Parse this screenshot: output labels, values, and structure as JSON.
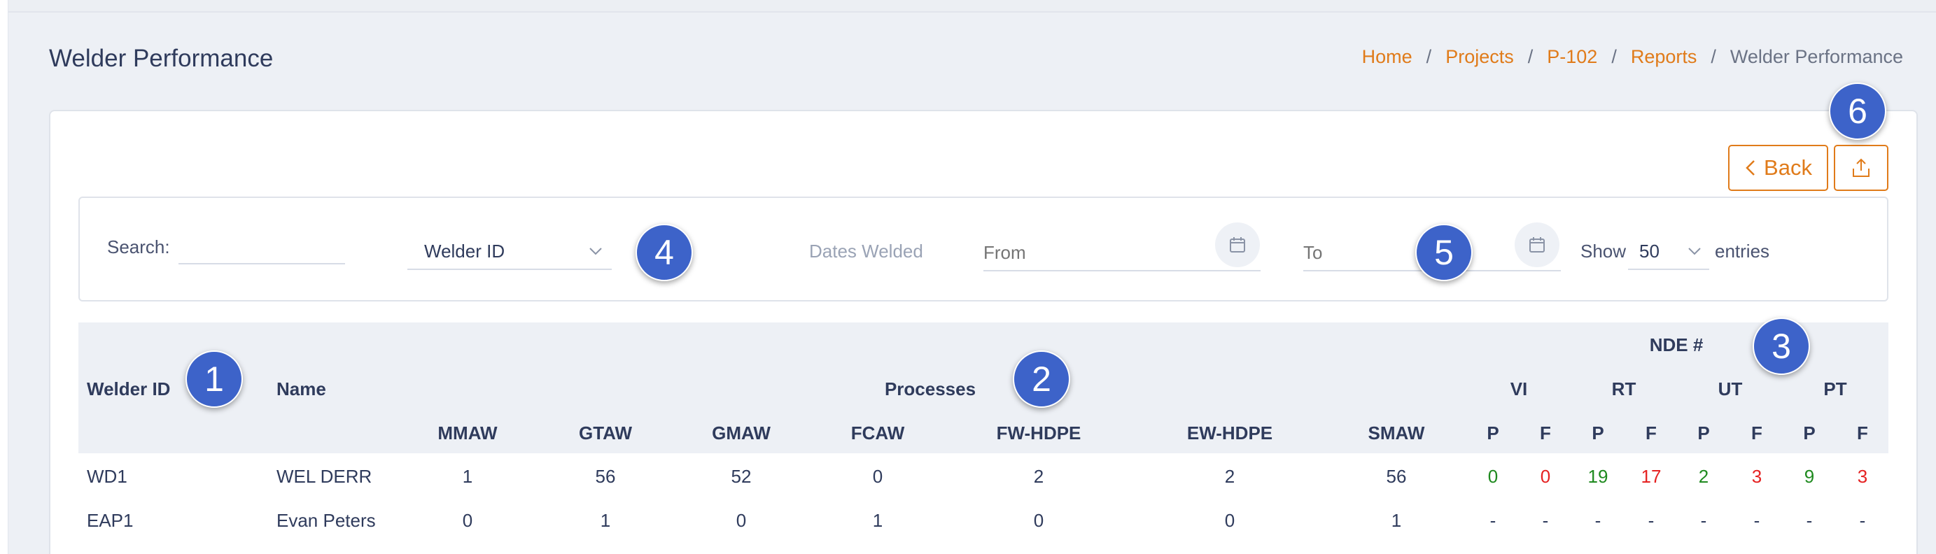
{
  "page": {
    "title": "Welder Performance"
  },
  "breadcrumb": {
    "items": [
      "Home",
      "Projects",
      "P-102",
      "Reports"
    ],
    "current": "Welder Performance",
    "separator": "/"
  },
  "toolbar": {
    "back_label": "Back",
    "back_icon": "chevron-left-icon",
    "export_icon": "share-upload-icon"
  },
  "filters": {
    "search_label": "Search:",
    "search_value": "",
    "search_field_selected": "Welder ID",
    "dates_label": "Dates Welded",
    "from_placeholder": "From",
    "to_placeholder": "To",
    "show_label": "Show",
    "page_size": "50",
    "entries_label": "entries"
  },
  "markers": [
    "1",
    "2",
    "3",
    "4",
    "5",
    "6"
  ],
  "table": {
    "headers": {
      "welder_id": "Welder ID",
      "name": "Name",
      "processes": "Processes",
      "nde": "NDE #",
      "process_columns": [
        "MMAW",
        "GTAW",
        "GMAW",
        "FCAW",
        "FW-HDPE",
        "EW-HDPE",
        "SMAW"
      ],
      "nde_groups": [
        "VI",
        "RT",
        "UT",
        "PT"
      ],
      "pf_labels": [
        "P",
        "F",
        "P",
        "F",
        "P",
        "F",
        "P",
        "F"
      ]
    },
    "rows": [
      {
        "welder_id": "WD1",
        "name": "WEL DERR",
        "processes": [
          "1",
          "56",
          "52",
          "0",
          "2",
          "2",
          "56"
        ],
        "nde": [
          "0",
          "0",
          "19",
          "17",
          "2",
          "3",
          "9",
          "3"
        ]
      },
      {
        "welder_id": "EAP1",
        "name": "Evan Peters",
        "processes": [
          "0",
          "1",
          "0",
          "1",
          "0",
          "0",
          "1"
        ],
        "nde": [
          "-",
          "-",
          "-",
          "-",
          "-",
          "-",
          "-",
          "-"
        ]
      }
    ]
  },
  "colors": {
    "accent": "#e07b1a",
    "marker": "#3d63c9",
    "pass": "#1f8a1f",
    "fail": "#e52222",
    "header_bg": "#edf0f5"
  }
}
